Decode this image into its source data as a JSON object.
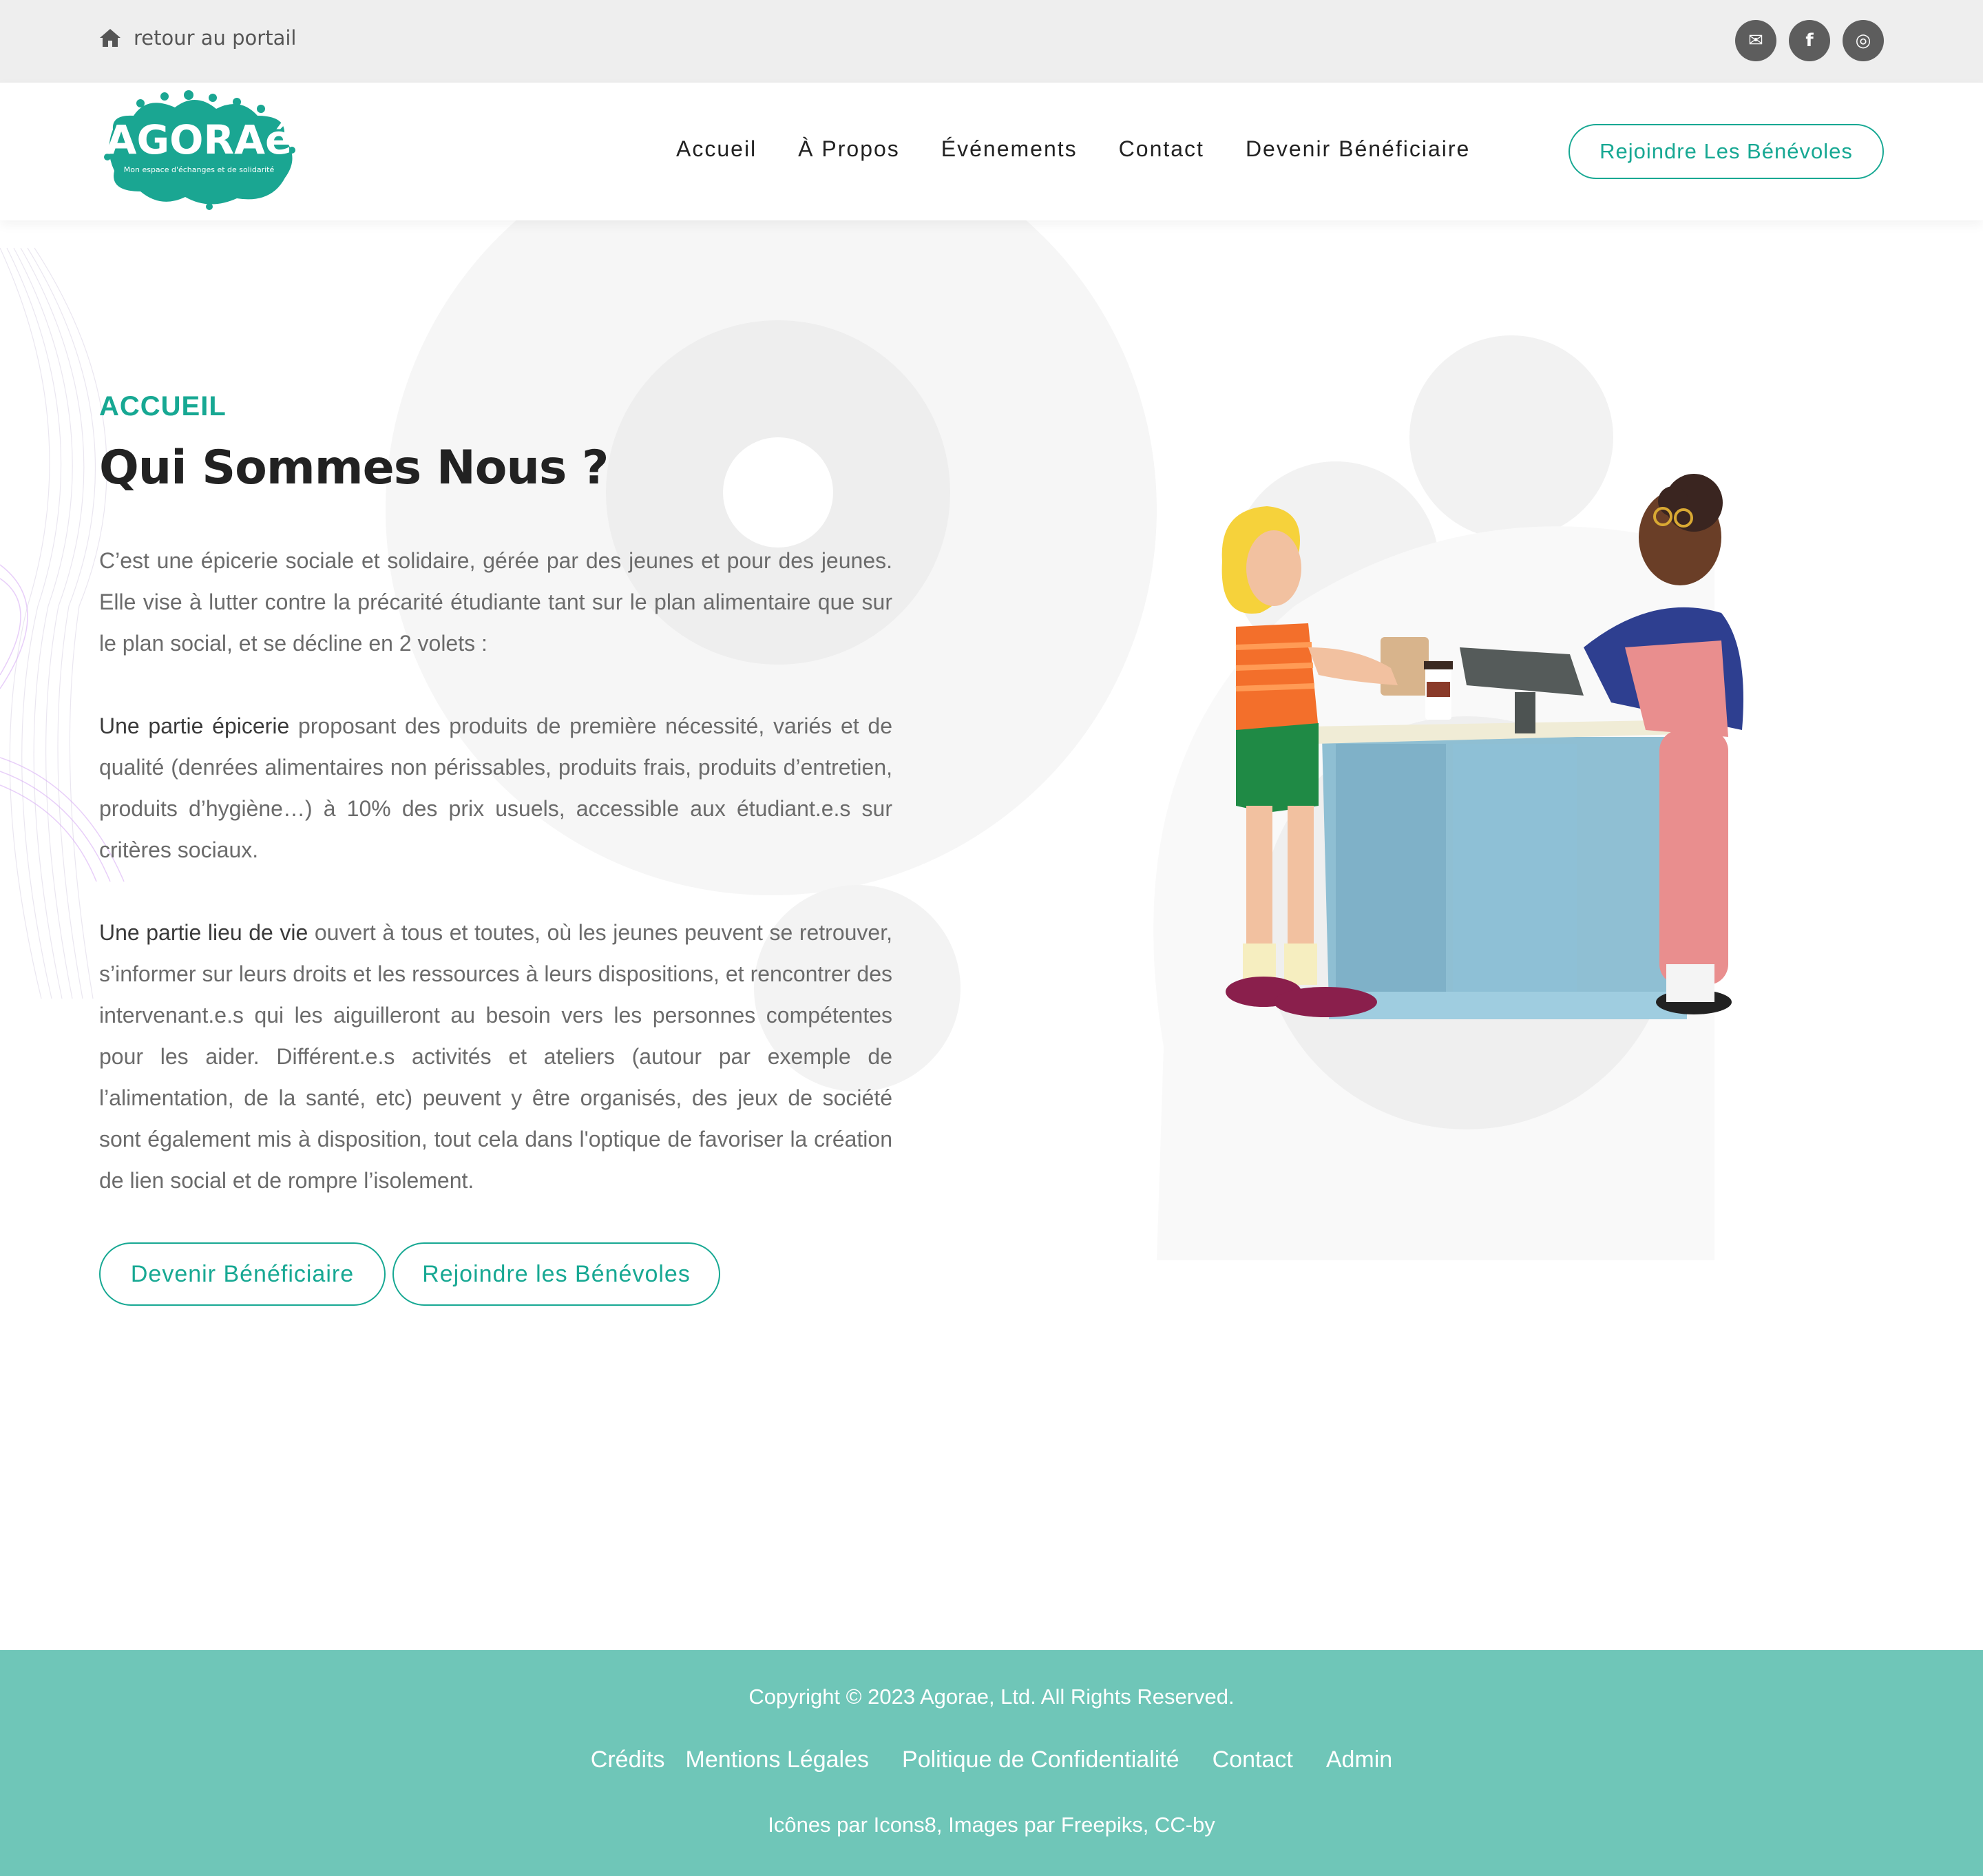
{
  "topbar": {
    "portal_link": "retour au portail",
    "socials": [
      {
        "icon": "envelope-icon",
        "glyph": "✉"
      },
      {
        "icon": "facebook-icon",
        "glyph": "f"
      },
      {
        "icon": "instagram-icon",
        "glyph": "◎"
      }
    ]
  },
  "header": {
    "logo_text": "AGORAé",
    "logo_tagline": "Mon espace d'échanges et de solidarité",
    "nav": [
      "Accueil",
      "À Propos",
      "Événements",
      "Contact",
      "Devenir Bénéficiaire"
    ],
    "join_button": "Rejoindre Les Bénévoles"
  },
  "hero": {
    "eyebrow": "ACCUEIL",
    "title": "Qui Sommes Nous ?",
    "intro": "C’est une épicerie sociale et solidaire, gérée par des jeunes et pour des jeunes. Elle vise à lutter contre la précarité étudiante tant sur le plan alimentaire que sur le plan social, et se décline en 2 volets :",
    "part1_strong": "Une partie épicerie",
    "part1_text": " proposant des produits de première nécessité, variés et de qualité (denrées alimentaires non périssables, produits frais, produits d’entretien, produits d’hygiène…) à 10% des prix usuels, accessible aux étudiant.e.s sur critères sociaux.",
    "part2_strong": "Une partie lieu de vie",
    "part2_text": " ouvert à tous et toutes, où les jeunes peuvent se retrouver, s’informer sur leurs droits et les ressources à leurs dispositions, et rencontrer des intervenant.e.s qui les aiguilleront au besoin vers les personnes compétentes pour les aider. Différent.e.s activités et ateliers (autour par exemple de l’alimentation, de la santé, etc) peuvent y être organisés, des jeux de société sont également mis à disposition, tout cela dans l'optique de favoriser la création de lien social et de rompre l’isolement.",
    "cta_primary": "Devenir Bénéficiaire",
    "cta_secondary": "Rejoindre les Bénévoles"
  },
  "footer": {
    "copyright": "Copyright © 2023 Agorae, Ltd. All Rights Reserved.",
    "links": [
      "Crédits",
      "Mentions Légales",
      "Politique de Confidentialité",
      "Contact",
      "Admin"
    ],
    "credits": "Icônes par Icons8, Images par Freepiks, CC-by"
  },
  "colors": {
    "accent": "#17a893",
    "footer_bg": "#6fc6b8",
    "topbar_bg": "#eeeeee",
    "social_bg": "#5d5d5d"
  }
}
